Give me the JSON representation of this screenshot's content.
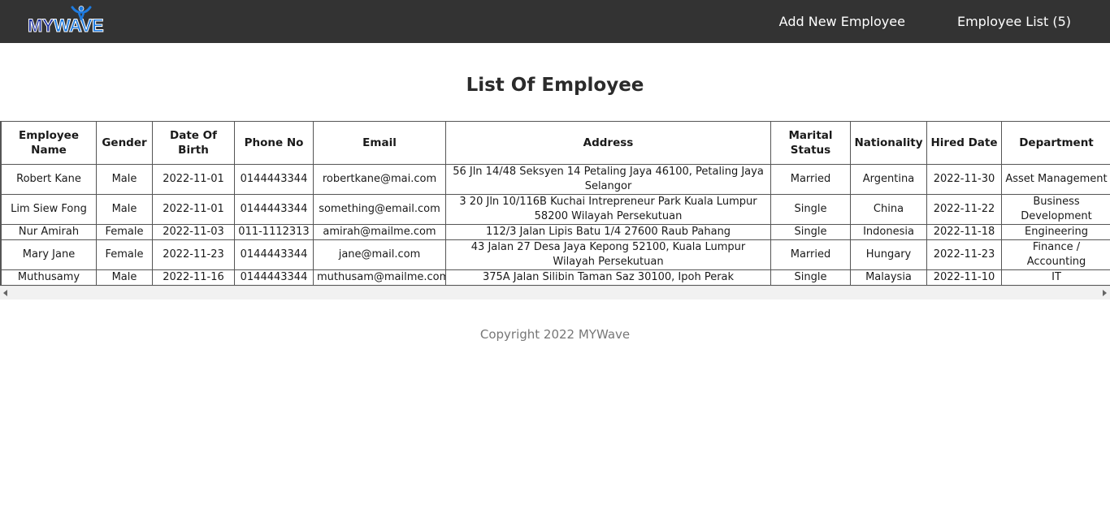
{
  "navbar": {
    "logo": {
      "part1": "MY",
      "part2": "WAVE"
    },
    "links": [
      "Add New Employee",
      "Employee List (5)"
    ]
  },
  "page_title": "List Of Employee",
  "table": {
    "headers": [
      "Employee Name",
      "Gender",
      "Date Of Birth",
      "Phone No",
      "Email",
      "Address",
      "Marital Status",
      "Nationality",
      "Hired Date",
      "Department"
    ],
    "rows": [
      [
        "Robert Kane",
        "Male",
        "2022-11-01",
        "0144443344",
        "robertkane@mai.com",
        "56 Jln 14/48 Seksyen 14 Petaling Jaya 46100, Petaling Jaya Selangor",
        "Married",
        "Argentina",
        "2022-11-30",
        "Asset Management"
      ],
      [
        "Lim Siew Fong",
        "Male",
        "2022-11-01",
        "0144443344",
        "something@email.com",
        "3 20 Jln 10/116B Kuchai Intrepreneur Park Kuala Lumpur 58200 Wilayah Persekutuan",
        "Single",
        "China",
        "2022-11-22",
        "Business Development"
      ],
      [
        "Nur Amirah",
        "Female",
        "2022-11-03",
        "011-1112313",
        "amirah@mailme.com",
        "112/3 Jalan Lipis Batu 1/4 27600 Raub Pahang",
        "Single",
        "Indonesia",
        "2022-11-18",
        "Engineering"
      ],
      [
        "Mary Jane",
        "Female",
        "2022-11-23",
        "0144443344",
        "jane@mail.com",
        "43 Jalan 27 Desa Jaya Kepong 52100, Kuala Lumpur Wilayah Persekutuan",
        "Married",
        "Hungary",
        "2022-11-23",
        "Finance / Accounting"
      ],
      [
        "Muthusamy",
        "Male",
        "2022-11-16",
        "0144443344",
        "muthusam@mailme.com",
        "375A Jalan Silibin Taman Saz 30100, Ipoh Perak",
        "Single",
        "Malaysia",
        "2022-11-10",
        "IT"
      ]
    ]
  },
  "scrollbar": {
    "left_icon": "chevron-left-icon",
    "right_icon": "chevron-right-icon"
  },
  "footer": "Copyright 2022 MYWave",
  "colors": {
    "navbar_bg": "#333333",
    "logo_dark": "#1b2f9e",
    "logo_light": "#1e7be0"
  }
}
